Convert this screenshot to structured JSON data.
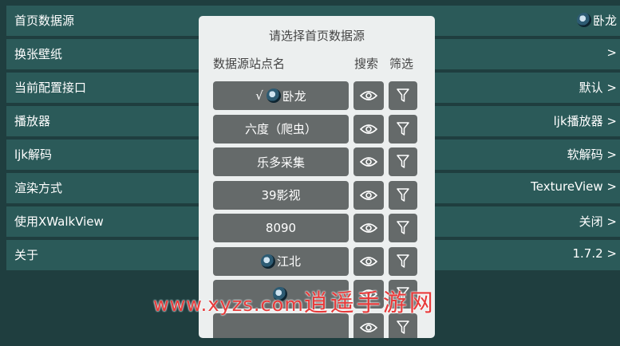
{
  "settings": [
    {
      "label": "首页数据源",
      "value": "卧龙",
      "has_avatar": true
    },
    {
      "label": "换张壁纸",
      "value": ">"
    },
    {
      "label": "当前配置接口",
      "value": "默认 >"
    },
    {
      "label": "播放器",
      "value": "ljk播放器 >"
    },
    {
      "label": "ljk解码",
      "value": "软解码 >"
    },
    {
      "label": "渲染方式",
      "value": "TextureView >"
    },
    {
      "label": "使用XWalkView",
      "value": "关闭 >"
    },
    {
      "label": "关于",
      "value": "1.7.2 >"
    }
  ],
  "dialog": {
    "title": "请选择首页数据源",
    "headers": {
      "name": "数据源站点名",
      "search": "搜索",
      "filter": "筛选"
    },
    "sources": [
      {
        "name": "卧龙",
        "checked": true,
        "checkmark": "√",
        "has_avatar": true
      },
      {
        "name": "六度（爬虫）"
      },
      {
        "name": "乐多采集"
      },
      {
        "name": "39影视"
      },
      {
        "name": "8090"
      },
      {
        "name": "江北",
        "has_avatar": true
      },
      {
        "name": "",
        "has_avatar": true,
        "partial": true
      },
      {
        "name": "",
        "partial": true
      }
    ]
  },
  "watermark": {
    "url": "www.xyzs.com",
    "cn": "逍遥手游网"
  },
  "icons": {
    "search": "eye-icon",
    "filter": "funnel-icon"
  },
  "colors": {
    "background": "#1f3e3f",
    "row": "#2b5a59",
    "dialog": "#ecefef",
    "button": "#656a6a",
    "watermark": "#e83a3a"
  }
}
